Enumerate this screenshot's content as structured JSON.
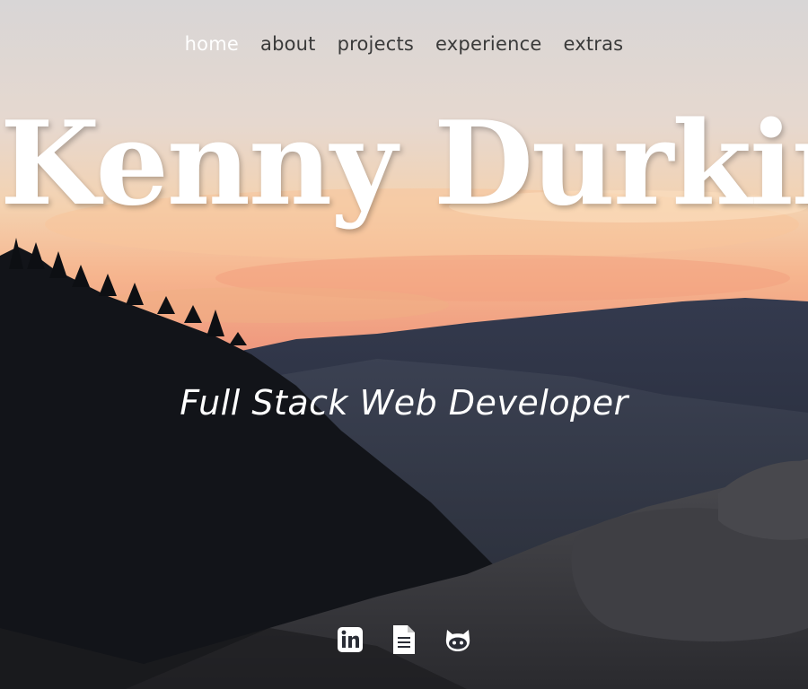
{
  "nav": {
    "items": [
      {
        "label": "home",
        "active": true
      },
      {
        "label": "about",
        "active": false
      },
      {
        "label": "projects",
        "active": false
      },
      {
        "label": "experience",
        "active": false
      },
      {
        "label": "extras",
        "active": false
      }
    ]
  },
  "hero": {
    "name": "Kenny Durkin",
    "tagline": "Full Stack Web Developer"
  },
  "social": {
    "icons": [
      "linkedin-icon",
      "resume-document-icon",
      "github-icon"
    ]
  },
  "colors": {
    "nav_text": "#3a3a3a",
    "nav_active": "#ffffff",
    "heading": "#ffffff",
    "sky_top": "#d9d6d5",
    "sky_glow": "#f2a27c",
    "mountain": "#2b3040"
  }
}
